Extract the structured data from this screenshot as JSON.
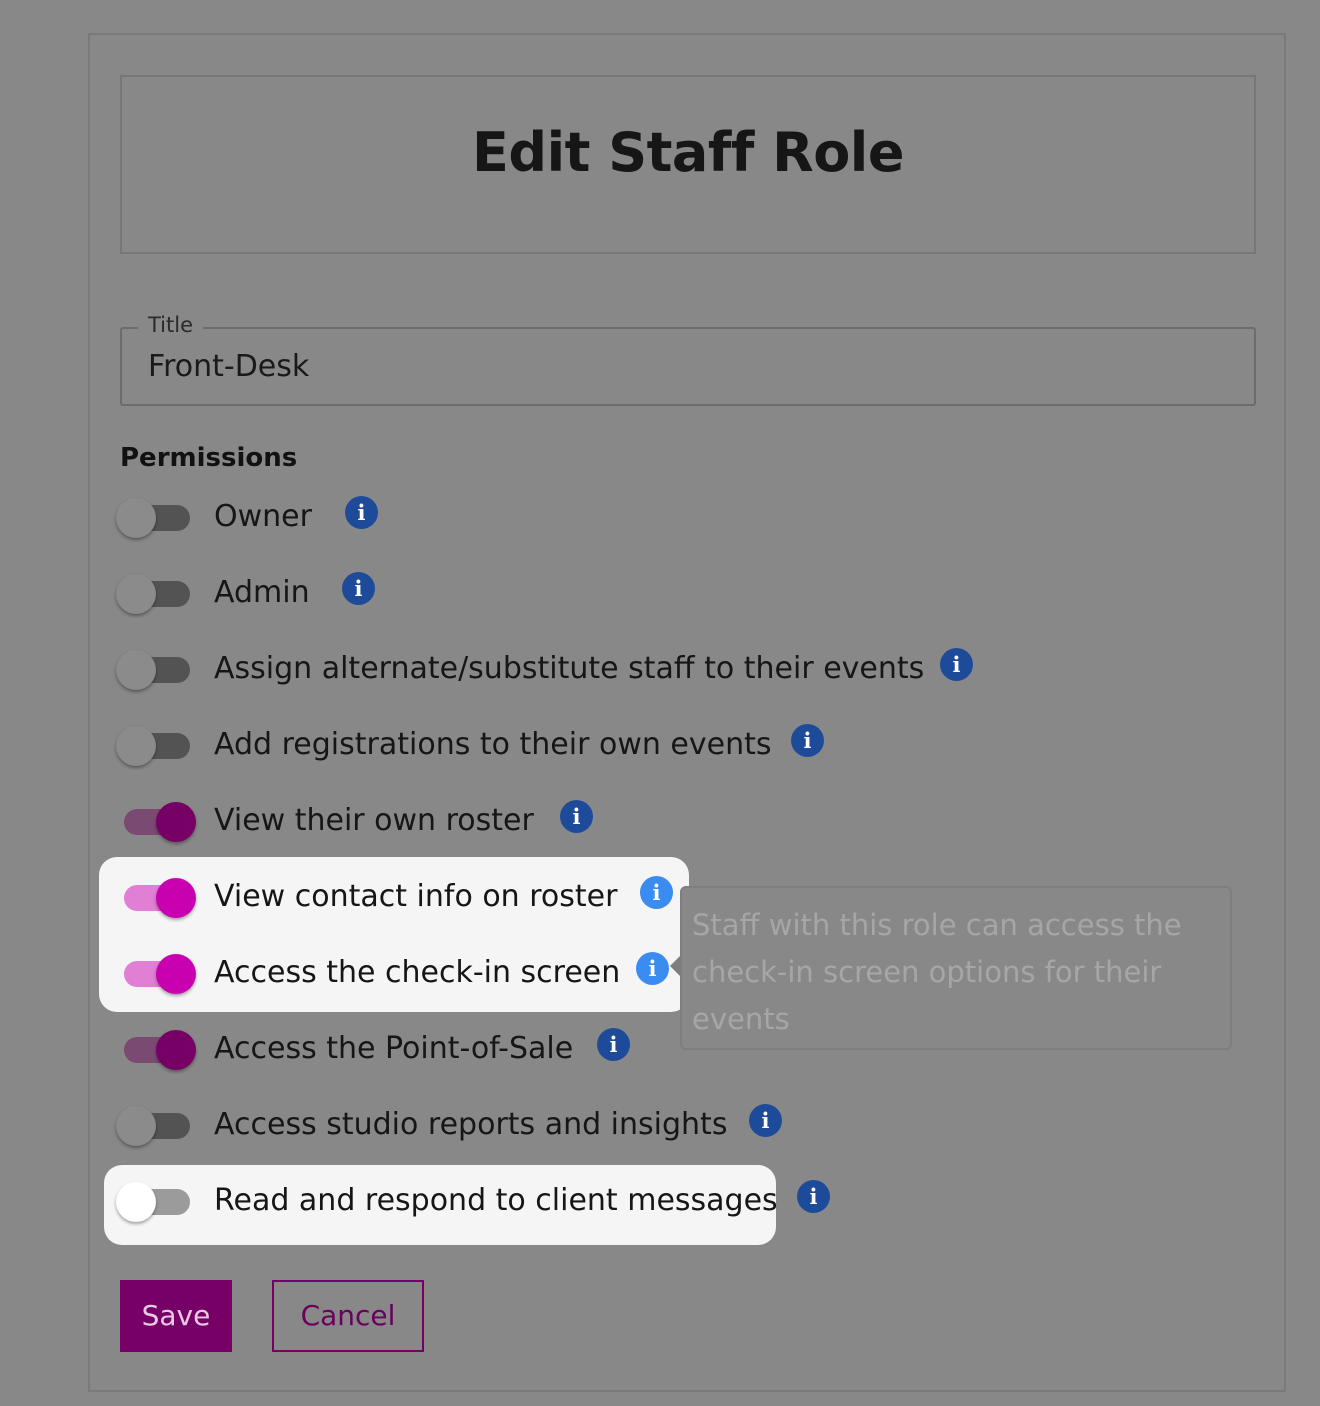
{
  "header": {
    "title": "Edit Staff Role"
  },
  "title_field": {
    "label": "Title",
    "value": "Front-Desk"
  },
  "permissions": {
    "heading": "Permissions",
    "items": [
      {
        "label": "Owner",
        "enabled": false
      },
      {
        "label": "Admin",
        "enabled": false
      },
      {
        "label": "Assign alternate/substitute staff to their events",
        "enabled": false
      },
      {
        "label": "Add registrations to their own events",
        "enabled": false
      },
      {
        "label": "View their own roster",
        "enabled": true
      },
      {
        "label": "View contact info on roster",
        "enabled": true
      },
      {
        "label": "Access the check-in screen",
        "enabled": true
      },
      {
        "label": "Access the Point-of-Sale",
        "enabled": true
      },
      {
        "label": "Access studio reports and insights",
        "enabled": false
      },
      {
        "label": "Read and respond to client messages",
        "enabled": false
      }
    ],
    "info_glyph": "i",
    "info_icon": "info-circle-icon"
  },
  "tooltip": {
    "text": "Staff with this role can access the check-in screen options for their events"
  },
  "actions": {
    "save_label": "Save",
    "cancel_label": "Cancel"
  },
  "colors": {
    "accent": "#760066",
    "accent_highlight": "#c800b0",
    "info_icon": "#1d4b9a",
    "info_icon_highlight": "#3a8cf0",
    "overlay": "#888888"
  }
}
